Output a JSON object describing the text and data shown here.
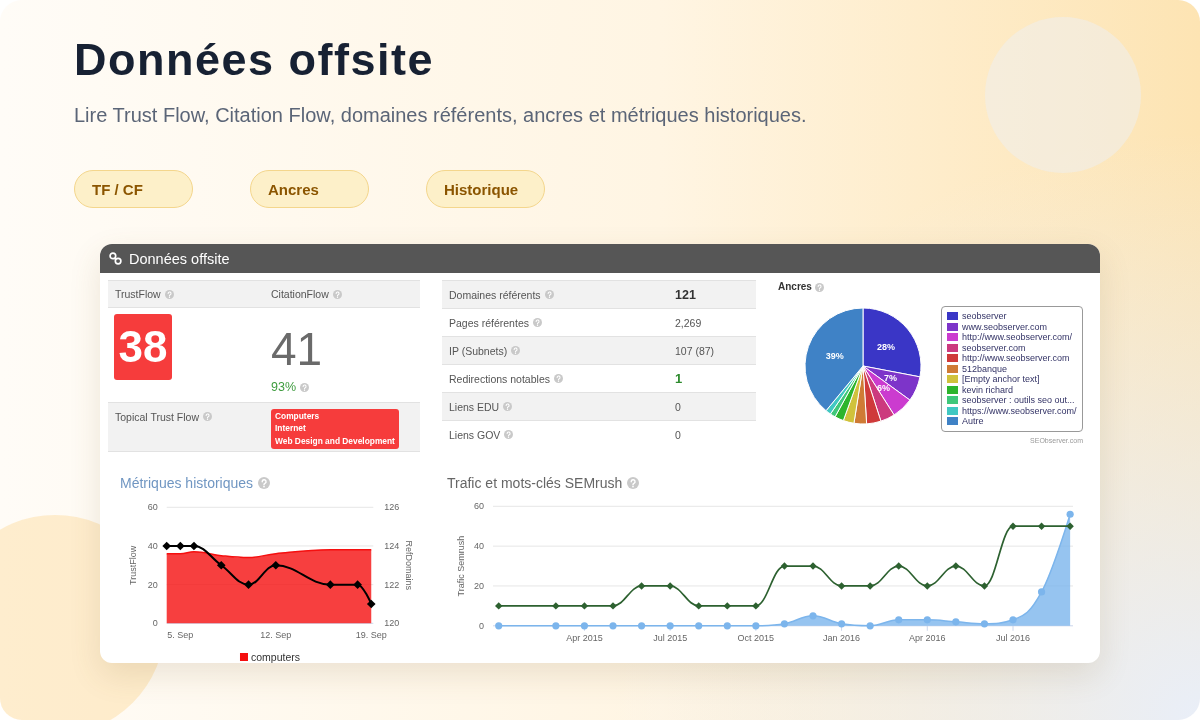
{
  "hero": {
    "title": "Données offsite",
    "subtitle": "Lire Trust Flow, Citation Flow, domaines référents, ancres et métriques historiques.",
    "tags": [
      "TF / CF",
      "Ancres",
      "Historique"
    ]
  },
  "panel": {
    "title": "Données offsite",
    "flow": {
      "columns": [
        "TrustFlow",
        "CitationFlow"
      ],
      "trust_flow": "38",
      "citation_flow": "41",
      "ratio": "93%",
      "topical_label": "Topical Trust Flow",
      "topics": [
        "Computers",
        "Internet",
        "Web Design and Development"
      ]
    },
    "stats": [
      {
        "label": "Domaines référents",
        "value": "121",
        "kind": "headline"
      },
      {
        "label": "Pages référentes",
        "value": "2,269",
        "kind": "plain"
      },
      {
        "label": "IP (Subnets)",
        "value": "107 (87)",
        "kind": "plain"
      },
      {
        "label": "Redirections notables",
        "value": "1",
        "kind": "positive"
      },
      {
        "label": "Liens EDU",
        "value": "0",
        "kind": "plain"
      },
      {
        "label": "Liens GOV",
        "value": "0",
        "kind": "plain"
      }
    ],
    "anchors": {
      "legend": [
        {
          "label": "seobserver",
          "color": "#3a36c6"
        },
        {
          "label": "www.seobserver.com",
          "color": "#7d34c9"
        },
        {
          "label": "http://www.seobserver.com/",
          "color": "#cb3bcf"
        },
        {
          "label": "seobserver.com",
          "color": "#cc3a7e"
        },
        {
          "label": "http://www.seobserver.com",
          "color": "#cf3a3a"
        },
        {
          "label": "512banque",
          "color": "#cf7b35"
        },
        {
          "label": "[Empty anchor text]",
          "color": "#d0c23c"
        },
        {
          "label": "kevin richard",
          "color": "#2db52d"
        },
        {
          "label": "seobserver : outils seo out...",
          "color": "#3fc87a"
        },
        {
          "label": "https://www.seobserver.com/",
          "color": "#40c8c2"
        },
        {
          "label": "Autre",
          "color": "#3f82c6"
        }
      ],
      "credit": "SEObserver.com",
      "chart_data": {
        "type": "pie",
        "title": "Ancres",
        "series": [
          {
            "values": [
              28,
              7,
              6,
              4,
              4,
              3.5,
              3,
              2.5,
              1.5,
              1.5,
              39
            ]
          }
        ],
        "value_labels": [
          "28%",
          "7%",
          "6%",
          null,
          null,
          null,
          null,
          null,
          null,
          null,
          "39%"
        ]
      }
    },
    "history": {
      "chart_data": {
        "type": "line",
        "title": "Métriques historiques",
        "ylabel": "TrustFlow",
        "y2label": "RefDomains",
        "categories": [
          null,
          "5. Sep",
          null,
          null,
          null,
          null,
          null,
          null,
          "12. Sep",
          null,
          null,
          null,
          null,
          null,
          null,
          "19. Sep"
        ],
        "ylim": [
          0,
          60
        ],
        "yticks": [
          0,
          20,
          40,
          60
        ],
        "y2lim": [
          120,
          126
        ],
        "y2ticks": [
          120,
          122,
          124,
          126
        ],
        "series": [
          {
            "name": "computers",
            "type": "area",
            "marker": "none",
            "color": "#f50f0f",
            "values": [
              36,
              36,
              37,
              null,
              35,
              null,
              34,
              null,
              36,
              null,
              null,
              null,
              38,
              null,
              38,
              38
            ]
          },
          {
            "axis": "y2",
            "marker": "diamond",
            "color": "#000000",
            "values": [
              124,
              124,
              124,
              null,
              123,
              null,
              122,
              null,
              123,
              null,
              null,
              null,
              122,
              null,
              122,
              121
            ]
          }
        ]
      }
    },
    "semrush": {
      "chart_data": {
        "type": "line",
        "title": "Trafic et mots-clés SEMrush",
        "ylabel": "Trafic Semrush",
        "categories": [
          null,
          null,
          null,
          "Apr 2015",
          null,
          null,
          "Jul 2015",
          null,
          null,
          "Oct 2015",
          null,
          null,
          "Jan 2016",
          null,
          null,
          "Apr 2016",
          null,
          null,
          "Jul 2016",
          null,
          null
        ],
        "ylim": [
          0,
          60
        ],
        "yticks": [
          0,
          20,
          40,
          60
        ],
        "series": [
          {
            "marker": "diamond",
            "color": "#2d6130",
            "values": [
              10,
              null,
              10,
              10,
              10,
              20,
              20,
              10,
              10,
              10,
              30,
              30,
              20,
              20,
              30,
              20,
              30,
              20,
              50,
              50,
              50
            ]
          },
          {
            "type": "area",
            "marker": "circle",
            "color": "#7cb5ec",
            "values": [
              0,
              null,
              0,
              0,
              0,
              0,
              0,
              0,
              0,
              0,
              1,
              5,
              1,
              0,
              3,
              3,
              2,
              1,
              3,
              17,
              56
            ]
          }
        ]
      }
    }
  }
}
